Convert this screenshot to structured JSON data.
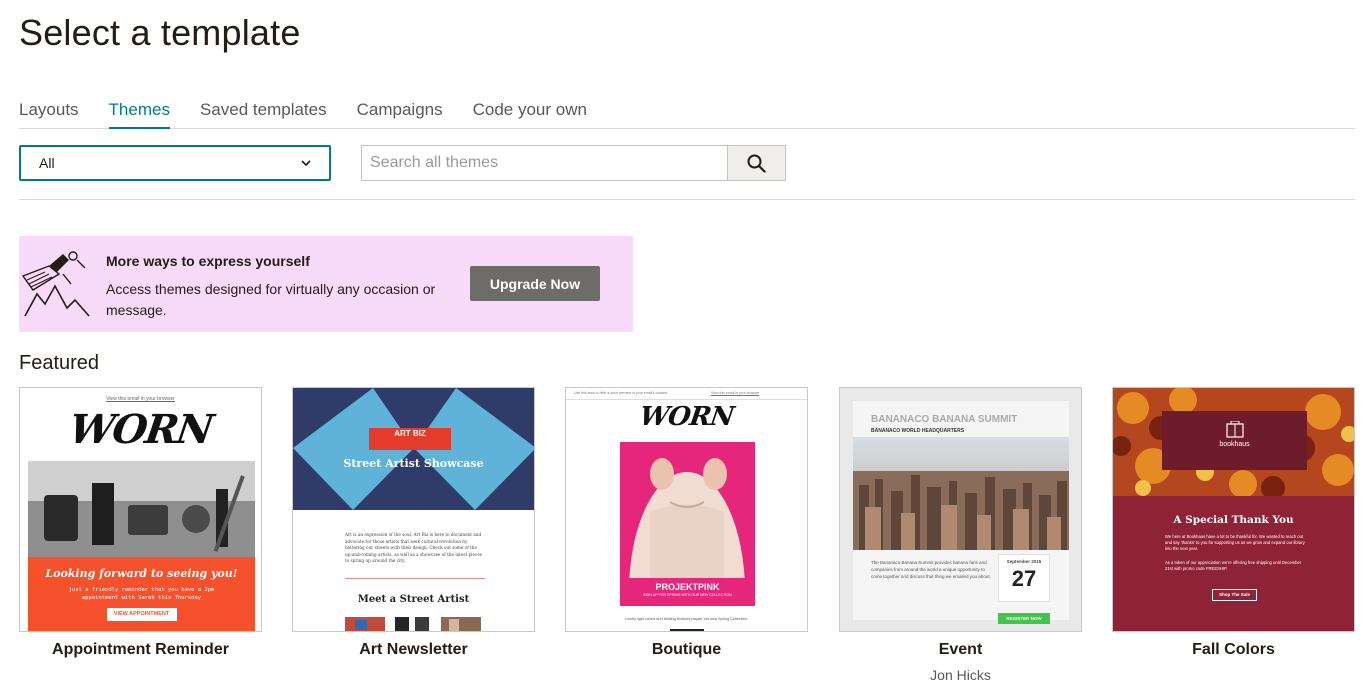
{
  "page": {
    "title": "Select a template"
  },
  "tabs": [
    {
      "label": "Layouts",
      "active": false
    },
    {
      "label": "Themes",
      "active": true
    },
    {
      "label": "Saved templates",
      "active": false
    },
    {
      "label": "Campaigns",
      "active": false
    },
    {
      "label": "Code your own",
      "active": false
    }
  ],
  "filter": {
    "selected": "All",
    "icon": "chevron-down-icon"
  },
  "search": {
    "placeholder": "Search all themes",
    "value": "",
    "icon": "search-icon"
  },
  "promo": {
    "title": "More ways to express yourself",
    "text": "Access themes designed for virtually any occasion or message.",
    "button_label": "Upgrade Now",
    "background": "#f8dbf8"
  },
  "featured": {
    "title": "Featured",
    "items": [
      {
        "name": "Appointment Reminder",
        "author": "",
        "thumb": {
          "browser_link": "View this email in your browser",
          "logo": "WORN",
          "headline": "Looking forward to seeing you!",
          "body": "just a friendly reminder that you have a 2pm appointment with Sarah this Thursday",
          "button": "VIEW APPOINTMENT"
        }
      },
      {
        "name": "Art Newsletter",
        "author": "",
        "thumb": {
          "logo_line1": "ART",
          "logo_line2": "BIZ",
          "headline": "Street Artist Showcase",
          "body": "Art is an expression of the soul. Art Biz is here to document and advocate for those artists that seek cultural revolution by bettering our streets with their design. Check out some of the up-and-coming artists, as well as a showcase of the latest pieces to spring up around the city.",
          "subheading": "Meet a Street Artist"
        }
      },
      {
        "name": "Boutique",
        "author": "",
        "thumb": {
          "top_text": "Use this area to offer a short preview of your email's content.",
          "top_link": "View this email in your browser",
          "logo": "WORN",
          "banner_title": "PROJEKTPINK",
          "banner_sub": "SIGN UP FOR SPRING WITH OUR NEW COLLECTION",
          "caption": "Lovely light colors and thrilling textures inspire our new Spring Collection."
        }
      },
      {
        "name": "Event",
        "author": "Jon Hicks",
        "thumb": {
          "title": "BANANACO BANANA SUMMIT",
          "subtitle": "BANANACO WORLD HEADQUARTERS",
          "body": "The Bananaco Banana Summit provides banana fans and companies from around the world a unique opportunity to come together and discuss that thing we emailed you about.",
          "month": "September 2015",
          "day": "27",
          "button": "REGISTER NOW"
        }
      },
      {
        "name": "Fall Colors",
        "author": "",
        "thumb": {
          "brand": "bookhaus",
          "headline": "A Special Thank You",
          "body": "We here at Bookhaus have a lot to be thankful for. We wanted to reach out and say 'thanks' to you for supporting us as we grow and expand our library into the next year.",
          "body2": "As a token of our appreciation we're offering free shipping until December 21st with promo code FREESHIP.",
          "button": "Shop The Sale"
        }
      }
    ]
  },
  "colors": {
    "accent": "#007c89",
    "text": "#241c15",
    "upgrade_button": "#6e6c69",
    "appointment_orange": "#f4512c",
    "boutique_pink": "#e6267b",
    "event_green": "#43c44a",
    "fall_maroon": "#8e2237"
  }
}
